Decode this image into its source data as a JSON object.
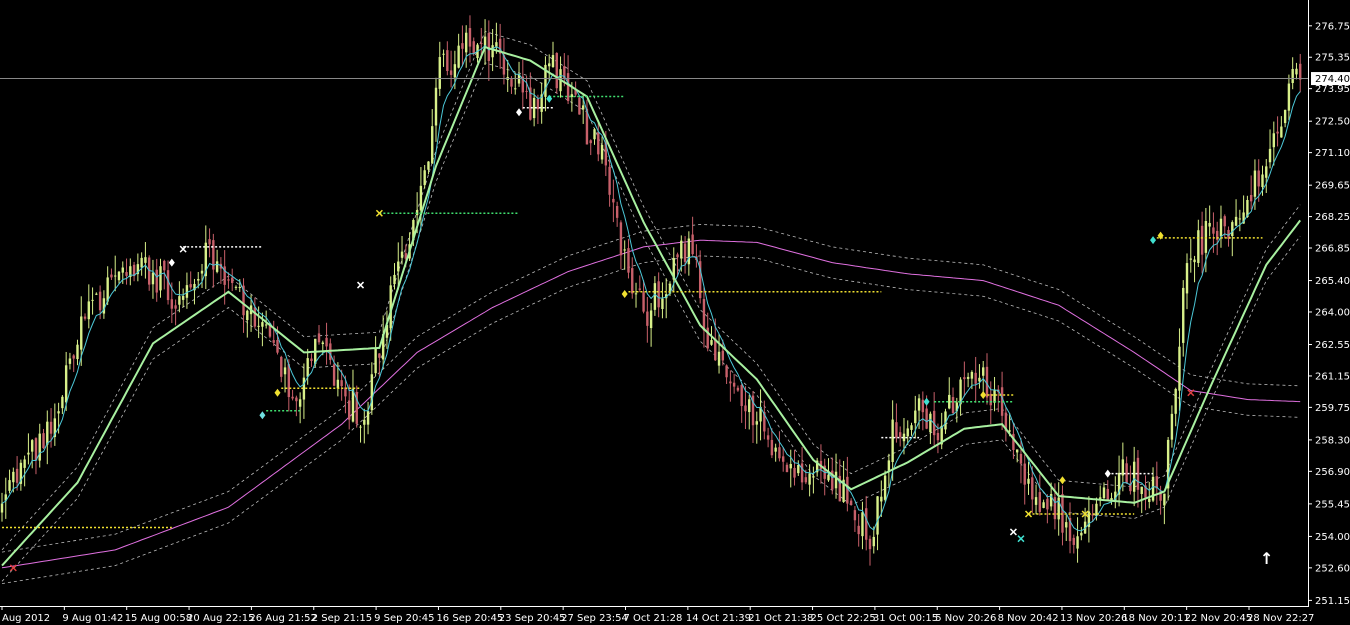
{
  "chart_data": {
    "type": "candlestick",
    "ylim": [
      250.9,
      277.9
    ],
    "price_ticks": [
      "276.75",
      "275.35",
      "273.95",
      "272.50",
      "271.10",
      "269.65",
      "268.25",
      "266.85",
      "265.40",
      "264.00",
      "262.55",
      "261.15",
      "259.75",
      "258.30",
      "256.90",
      "255.45",
      "254.00",
      "252.60",
      "251.15"
    ],
    "time_ticks": [
      "Aug 2012",
      "9 Aug 01:42",
      "15 Aug 00:58",
      "20 Aug 22:15",
      "26 Aug 21:52",
      "2 Sep 21:15",
      "9 Sep 20:45",
      "16 Sep 20:45",
      "23 Sep 20:45",
      "27 Sep 23:54",
      "7 Oct 21:28",
      "14 Oct 21:39",
      "21 Oct 21:38",
      "25 Oct 22:25",
      "31 Oct 00:15",
      "5 Nov 20:26",
      "8 Nov 20:42",
      "13 Nov 20:26",
      "18 Nov 20:11",
      "22 Nov 20:45",
      "28 Nov 22:27"
    ],
    "current_price": "274.40",
    "current_price_value": 274.4,
    "grid": false,
    "colors": {
      "background": "#000000",
      "bull_candle": "#d8f08a",
      "bear_candle": "#c8606a",
      "fast_ma": "#4cc8d8",
      "mid_ma": "#a8f0a0",
      "slow_ma": "#e070e0",
      "envelope": "#bbbbbb",
      "level_yellow": "#f0e030",
      "level_white": "#ffffff",
      "level_green": "#40e070",
      "axis_text": "#ffffff",
      "price_line": "#888888"
    },
    "anchor_closes": [
      [
        0,
        255.9
      ],
      [
        6,
        257.2
      ],
      [
        14,
        259.5
      ],
      [
        22,
        264.2
      ],
      [
        30,
        265.0
      ],
      [
        36,
        266.1
      ],
      [
        42,
        265.3
      ],
      [
        48,
        264.4
      ],
      [
        54,
        266.7
      ],
      [
        60,
        265.0
      ],
      [
        66,
        264.3
      ],
      [
        72,
        262.3
      ],
      [
        78,
        260.1
      ],
      [
        84,
        263.2
      ],
      [
        90,
        260.3
      ],
      [
        96,
        259.4
      ],
      [
        102,
        264.2
      ],
      [
        110,
        268.2
      ],
      [
        116,
        274.7
      ],
      [
        122,
        275.6
      ],
      [
        128,
        276.1
      ],
      [
        134,
        274.8
      ],
      [
        140,
        273.2
      ],
      [
        146,
        274.9
      ],
      [
        152,
        272.9
      ],
      [
        158,
        271.6
      ],
      [
        164,
        266.6
      ],
      [
        170,
        263.9
      ],
      [
        176,
        265.1
      ],
      [
        182,
        267.2
      ],
      [
        188,
        262.3
      ],
      [
        194,
        260.4
      ],
      [
        200,
        259.3
      ],
      [
        206,
        257.4
      ],
      [
        212,
        256.4
      ],
      [
        218,
        256.9
      ],
      [
        224,
        255.9
      ],
      [
        230,
        253.9
      ],
      [
        236,
        258.6
      ],
      [
        242,
        259.8
      ],
      [
        248,
        258.8
      ],
      [
        254,
        260.3
      ],
      [
        260,
        261.1
      ],
      [
        266,
        259.0
      ],
      [
        272,
        256.0
      ],
      [
        278,
        255.3
      ],
      [
        284,
        254.4
      ],
      [
        290,
        255.4
      ],
      [
        296,
        256.9
      ],
      [
        302,
        256.4
      ],
      [
        308,
        256.2
      ],
      [
        314,
        266.4
      ],
      [
        320,
        267.6
      ],
      [
        326,
        267.9
      ],
      [
        332,
        269.9
      ],
      [
        338,
        271.6
      ],
      [
        342,
        274.4
      ]
    ],
    "mid_ma": [
      [
        0,
        252.7
      ],
      [
        20,
        256.4
      ],
      [
        40,
        262.6
      ],
      [
        60,
        264.9
      ],
      [
        80,
        262.2
      ],
      [
        100,
        262.4
      ],
      [
        115,
        270.5
      ],
      [
        128,
        275.8
      ],
      [
        140,
        275.2
      ],
      [
        155,
        273.6
      ],
      [
        170,
        268.0
      ],
      [
        185,
        263.4
      ],
      [
        200,
        261.0
      ],
      [
        215,
        257.4
      ],
      [
        225,
        256.1
      ],
      [
        240,
        257.3
      ],
      [
        255,
        258.8
      ],
      [
        265,
        259.0
      ],
      [
        280,
        255.8
      ],
      [
        300,
        255.5
      ],
      [
        308,
        256.0
      ],
      [
        320,
        260.6
      ],
      [
        335,
        266.1
      ],
      [
        345,
        268.3
      ]
    ],
    "slow_ma": [
      [
        0,
        252.6
      ],
      [
        30,
        253.4
      ],
      [
        60,
        255.3
      ],
      [
        90,
        259.0
      ],
      [
        110,
        262.2
      ],
      [
        130,
        264.2
      ],
      [
        150,
        265.8
      ],
      [
        170,
        266.9
      ],
      [
        185,
        267.2
      ],
      [
        200,
        267.1
      ],
      [
        220,
        266.2
      ],
      [
        240,
        265.7
      ],
      [
        260,
        265.4
      ],
      [
        280,
        264.3
      ],
      [
        300,
        262.2
      ],
      [
        315,
        260.5
      ],
      [
        330,
        260.1
      ],
      [
        345,
        260.0
      ]
    ],
    "envelope_offset": 0.7,
    "levels": [
      {
        "from": 0,
        "to": 45,
        "price": 254.4,
        "color": "level_yellow"
      },
      {
        "from": 48,
        "to": 69,
        "price": 266.9,
        "color": "level_white"
      },
      {
        "from": 70,
        "to": 79,
        "price": 259.6,
        "color": "level_green"
      },
      {
        "from": 74,
        "to": 95,
        "price": 260.6,
        "color": "level_yellow"
      },
      {
        "from": 100,
        "to": 137,
        "price": 268.4,
        "color": "level_green"
      },
      {
        "from": 138,
        "to": 146,
        "price": 273.1,
        "color": "level_white"
      },
      {
        "from": 145,
        "to": 165,
        "price": 273.6,
        "color": "level_green"
      },
      {
        "from": 166,
        "to": 233,
        "price": 264.9,
        "color": "level_yellow"
      },
      {
        "from": 233,
        "to": 243,
        "price": 258.4,
        "color": "level_white"
      },
      {
        "from": 247,
        "to": 268,
        "price": 260.0,
        "color": "level_green"
      },
      {
        "from": 260,
        "to": 268,
        "price": 260.3,
        "color": "level_yellow"
      },
      {
        "from": 272,
        "to": 286,
        "price": 255.0,
        "color": "level_yellow"
      },
      {
        "from": 288,
        "to": 300,
        "price": 255.0,
        "color": "level_yellow"
      },
      {
        "from": 294,
        "to": 305,
        "price": 256.8,
        "color": "level_white"
      },
      {
        "from": 306,
        "to": 334,
        "price": 267.3,
        "color": "level_yellow"
      }
    ],
    "markers": [
      {
        "i": 3,
        "price": 252.6,
        "color": "#e04040",
        "glyph": "x"
      },
      {
        "i": 45,
        "price": 266.2,
        "color": "#ffffff",
        "glyph": "diamond"
      },
      {
        "i": 48,
        "price": 266.8,
        "color": "#ffffff",
        "glyph": "x"
      },
      {
        "i": 69,
        "price": 259.4,
        "color": "#70e0e0",
        "glyph": "diamond"
      },
      {
        "i": 73,
        "price": 260.4,
        "color": "#f0e030",
        "glyph": "diamond"
      },
      {
        "i": 95,
        "price": 265.2,
        "color": "#ffffff",
        "glyph": "x"
      },
      {
        "i": 100,
        "price": 268.4,
        "color": "#f0e030",
        "glyph": "x"
      },
      {
        "i": 137,
        "price": 272.9,
        "color": "#ffffff",
        "glyph": "diamond"
      },
      {
        "i": 145,
        "price": 273.5,
        "color": "#40e0d0",
        "glyph": "diamond"
      },
      {
        "i": 165,
        "price": 264.8,
        "color": "#f0e030",
        "glyph": "diamond"
      },
      {
        "i": 245,
        "price": 260.0,
        "color": "#40e0d0",
        "glyph": "diamond"
      },
      {
        "i": 260,
        "price": 260.3,
        "color": "#f0e030",
        "glyph": "diamond"
      },
      {
        "i": 268,
        "price": 254.2,
        "color": "#ffffff",
        "glyph": "x"
      },
      {
        "i": 270,
        "price": 253.9,
        "color": "#40e0d0",
        "glyph": "x"
      },
      {
        "i": 272,
        "price": 255.0,
        "color": "#f0e030",
        "glyph": "x"
      },
      {
        "i": 281,
        "price": 256.5,
        "color": "#f0e030",
        "glyph": "diamond"
      },
      {
        "i": 287,
        "price": 255.0,
        "color": "#f0e030",
        "glyph": "x"
      },
      {
        "i": 293,
        "price": 256.8,
        "color": "#ffffff",
        "glyph": "diamond"
      },
      {
        "i": 305,
        "price": 267.2,
        "color": "#40e0d0",
        "glyph": "diamond"
      },
      {
        "i": 307,
        "price": 267.4,
        "color": "#f0e030",
        "glyph": "diamond"
      },
      {
        "i": 315,
        "price": 260.4,
        "color": "#e04040",
        "glyph": "x"
      }
    ],
    "arrow": "↑"
  }
}
